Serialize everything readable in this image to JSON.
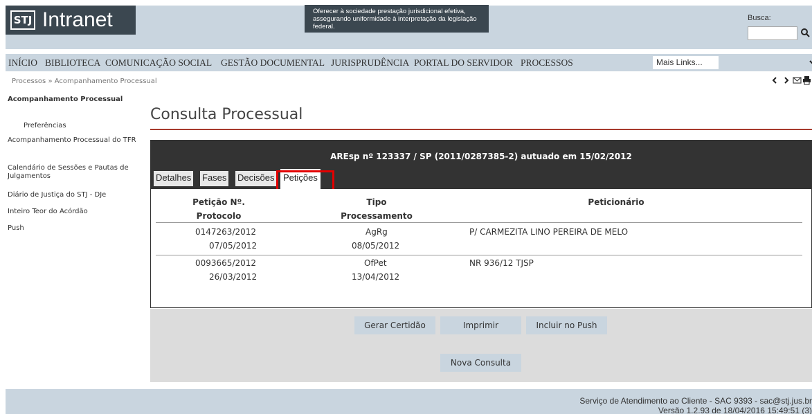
{
  "header": {
    "logo_abbr": "STJ",
    "logo_text": "Intranet",
    "tagline": "Oferecer à sociedade prestação jurisdicional efetiva, assegurando uniformidade à interpretação da legislação federal.",
    "search_label": "Busca:",
    "search_value": ""
  },
  "nav": {
    "items": [
      "INÍCIO",
      "BIBLIOTECA",
      "COMUNICAÇÃO SOCIAL",
      "GESTÃO DOCUMENTAL",
      "JURISPRUDÊNCIA",
      "PORTAL DO SERVIDOR",
      "PROCESSOS"
    ],
    "more_links": "Mais Links..."
  },
  "breadcrumb": "Processos » Acompanhamento Processual",
  "sidebar": {
    "active": "Acompanhamento Processual",
    "sub": "Preferências",
    "items": [
      "Acompanhamento Processual do TFR",
      "Calendário de Sessões e Pautas de Julgamentos",
      "Diário de Justiça do STJ - DJe",
      "Inteiro Teor do Acórdão",
      "Push"
    ]
  },
  "page_title": "Consulta Processual",
  "process_title": "AREsp nº 123337 / SP (2011/0287385-2) autuado em 15/02/2012",
  "tabs": [
    "Detalhes",
    "Fases",
    "Decisões",
    "Petições"
  ],
  "table": {
    "headers": [
      "Petição Nº.",
      "Protocolo",
      "Tipo",
      "Processamento",
      "Peticionário"
    ],
    "rows": [
      {
        "peticao": "0147263/2012",
        "protocolo": "07/05/2012",
        "tipo": "AgRg",
        "processamento": "08/05/2012",
        "peticionario": "P/ CARMEZITA LINO PEREIRA DE MELO"
      },
      {
        "peticao": "0093665/2012",
        "protocolo": "26/03/2012",
        "tipo": "OfPet",
        "processamento": "13/04/2012",
        "peticionario": "NR 936/12 TJSP"
      }
    ]
  },
  "buttons": {
    "gerar": "Gerar Certidão",
    "imprimir": "Imprimir",
    "incluir": "Incluir no Push",
    "nova": "Nova Consulta"
  },
  "footer": {
    "line1": "Serviço de Atendimento ao Cliente - SAC 9393 - sac@stj.jus.br",
    "line2": "Versão 1.2.93 de 18/04/2016 15:49:51 (3)"
  },
  "colors": {
    "header_bg": "#c9d5df",
    "dark": "#3b4750",
    "accent_rule": "#a73a2d",
    "highlight": "#e30000"
  }
}
